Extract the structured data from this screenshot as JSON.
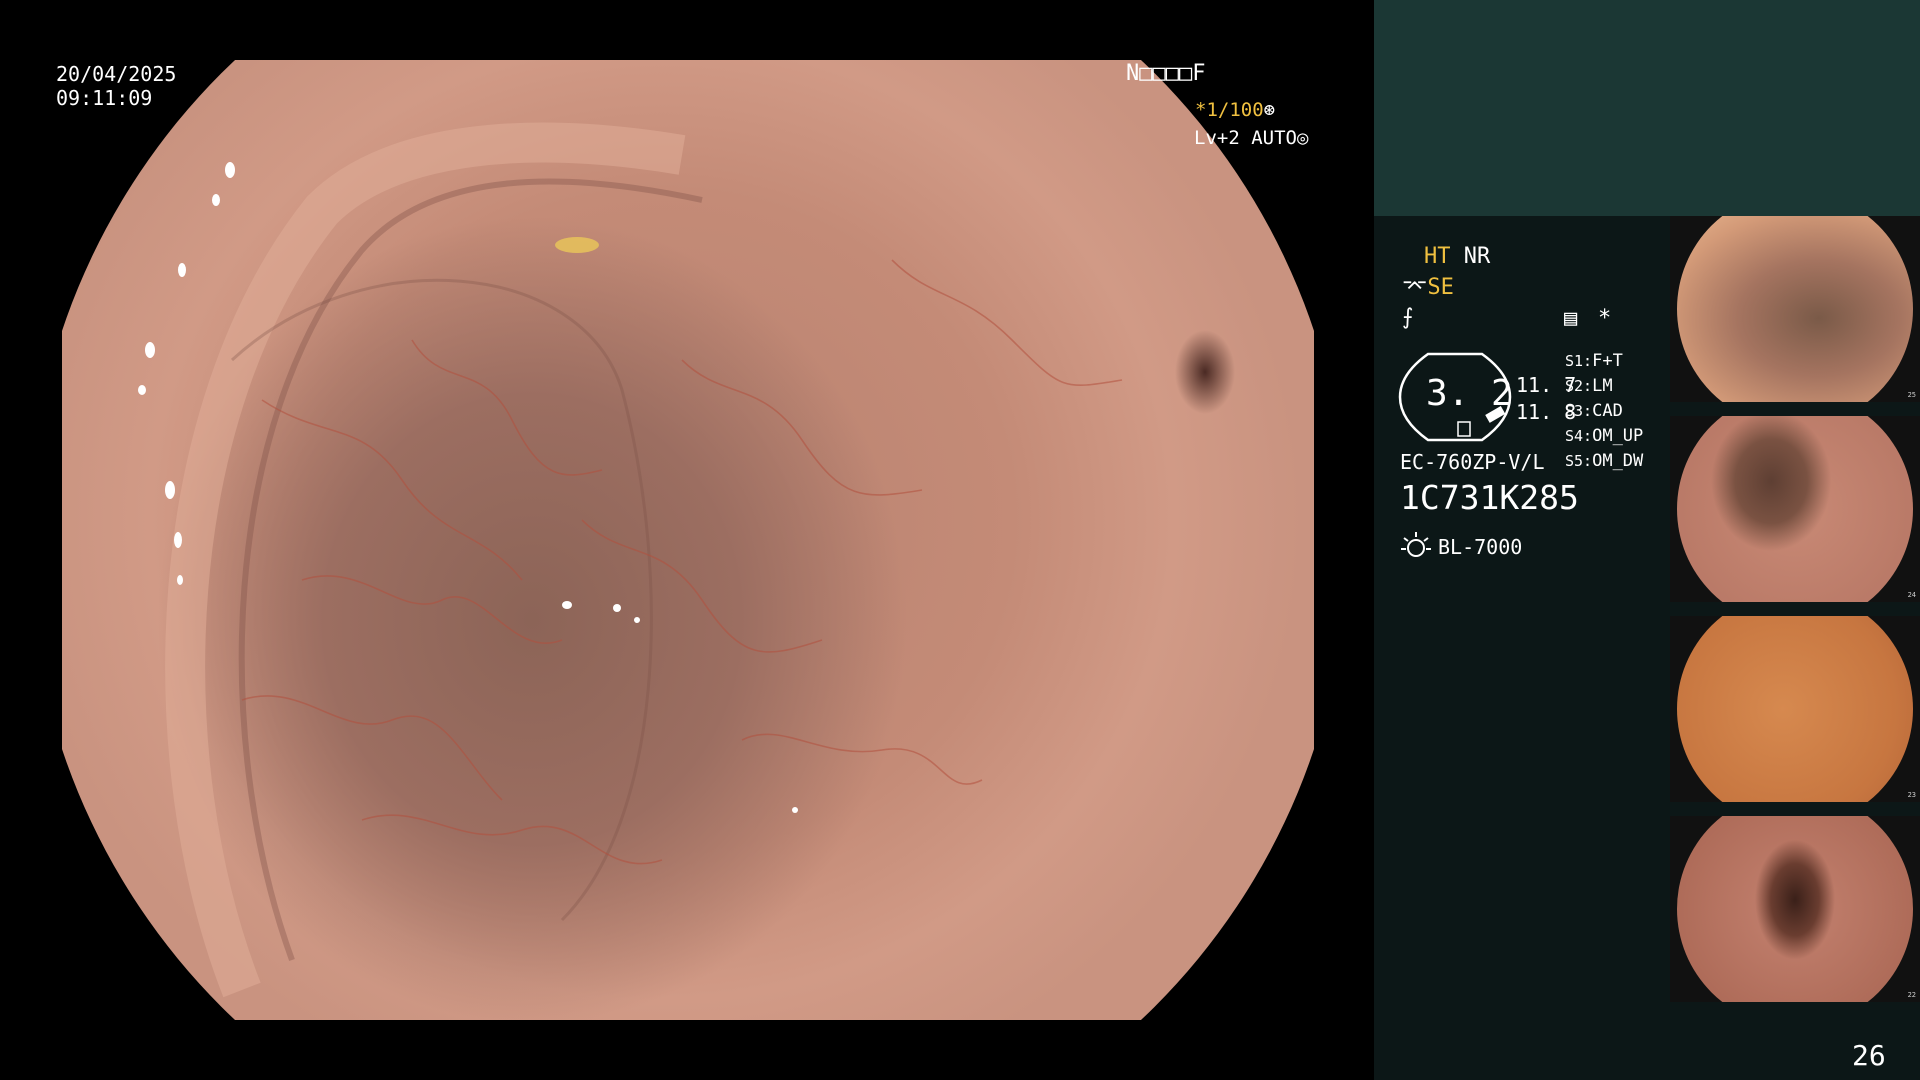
{
  "overlay": {
    "date": "20/04/2025",
    "time": "09:11:09",
    "top_code": "N□□□□F",
    "zoom": "*1/100",
    "level": "Lv+2 AUTO"
  },
  "sidebar": {
    "ht": "HT",
    "nr": "NR",
    "se": "SE",
    "star": "*",
    "gauge_value": "3. 2",
    "value1": "11. 7",
    "value2": "11. 8",
    "model": "EC-760ZP-V/L",
    "serial": "1C731K285",
    "light": "BL-7000",
    "slots": [
      {
        "key": "S1:",
        "value": "F+T"
      },
      {
        "key": "S2:",
        "value": "LM"
      },
      {
        "key": "S3:",
        "value": "CAD"
      },
      {
        "key": "S4:",
        "value": "OM_UP"
      },
      {
        "key": "S5:",
        "value": "OM_DW"
      }
    ],
    "thumbnails": [
      {
        "num": "25"
      },
      {
        "num": "24"
      },
      {
        "num": "23"
      },
      {
        "num": "22"
      }
    ]
  },
  "page_number": "26",
  "colors": {
    "accent_yellow": "#f0c040",
    "sidebar_bg": "#0c1717",
    "sidebar_top_bg": "#1b3734",
    "mucosa": "#c48b77"
  }
}
